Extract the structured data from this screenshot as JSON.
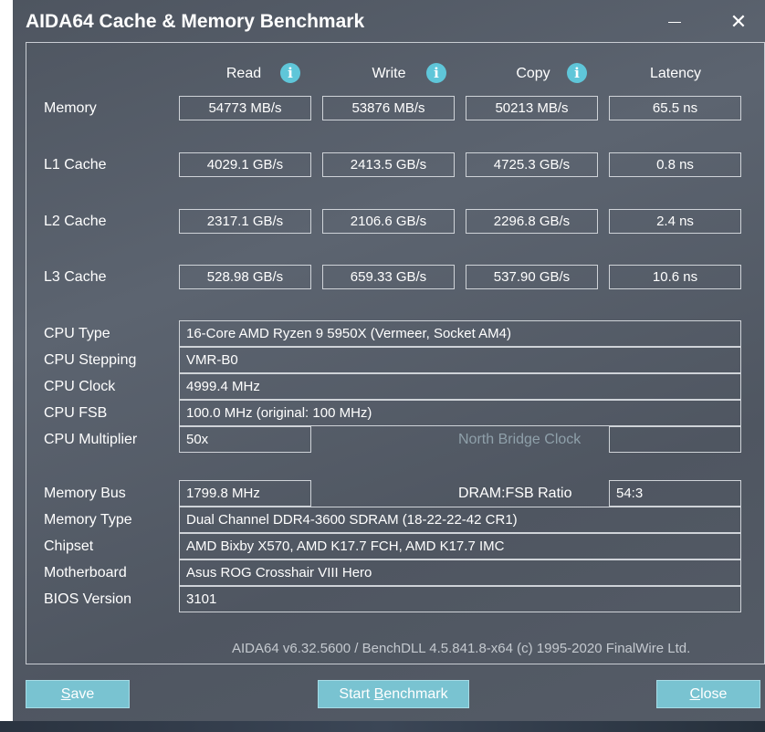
{
  "window": {
    "title": "AIDA64 Cache & Memory Benchmark"
  },
  "headers": {
    "read": "Read",
    "write": "Write",
    "copy": "Copy",
    "latency": "Latency"
  },
  "rows": [
    {
      "label": "Memory",
      "read": "54773 MB/s",
      "write": "53876 MB/s",
      "copy": "50213 MB/s",
      "latency": "65.5 ns"
    },
    {
      "label": "L1 Cache",
      "read": "4029.1 GB/s",
      "write": "2413.5 GB/s",
      "copy": "4725.3 GB/s",
      "latency": "0.8 ns"
    },
    {
      "label": "L2 Cache",
      "read": "2317.1 GB/s",
      "write": "2106.6 GB/s",
      "copy": "2296.8 GB/s",
      "latency": "2.4 ns"
    },
    {
      "label": "L3 Cache",
      "read": "528.98 GB/s",
      "write": "659.33 GB/s",
      "copy": "537.90 GB/s",
      "latency": "10.6 ns"
    }
  ],
  "cpu": {
    "type_label": "CPU Type",
    "type_value": "16-Core AMD Ryzen 9 5950X  (Vermeer, Socket AM4)",
    "stepping_label": "CPU Stepping",
    "stepping_value": "VMR-B0",
    "clock_label": "CPU Clock",
    "clock_value": "4999.4 MHz",
    "fsb_label": "CPU FSB",
    "fsb_value": "100.0 MHz  (original: 100 MHz)",
    "multiplier_label": "CPU Multiplier",
    "multiplier_value": "50x",
    "nb_clock_label": "North Bridge Clock",
    "nb_clock_value": ""
  },
  "memory": {
    "bus_label": "Memory Bus",
    "bus_value": "1799.8 MHz",
    "ratio_label": "DRAM:FSB Ratio",
    "ratio_value": "54:3",
    "type_label": "Memory Type",
    "type_value": "Dual Channel DDR4-3600 SDRAM  (18-22-22-42 CR1)",
    "chipset_label": "Chipset",
    "chipset_value": "AMD Bixby X570, AMD K17.7 FCH, AMD K17.7 IMC",
    "motherboard_label": "Motherboard",
    "motherboard_value": "Asus ROG Crosshair VIII Hero",
    "bios_label": "BIOS Version",
    "bios_value": "3101"
  },
  "footer": "AIDA64 v6.32.5600 / BenchDLL 4.5.841.8-x64  (c) 1995-2020 FinalWire Ltd.",
  "buttons": {
    "save_first": "S",
    "save_rest": "ave",
    "start_first": "Start ",
    "start_u": "B",
    "start_rest": "enchmark",
    "close_first": "C",
    "close_rest": "lose"
  },
  "icons": {
    "info": "info-icon",
    "minimize": "minimize-icon",
    "close": "close-icon"
  },
  "colors": {
    "window_bg": "#555c67",
    "accent": "#79c3d1",
    "info": "#5fc6d9"
  }
}
